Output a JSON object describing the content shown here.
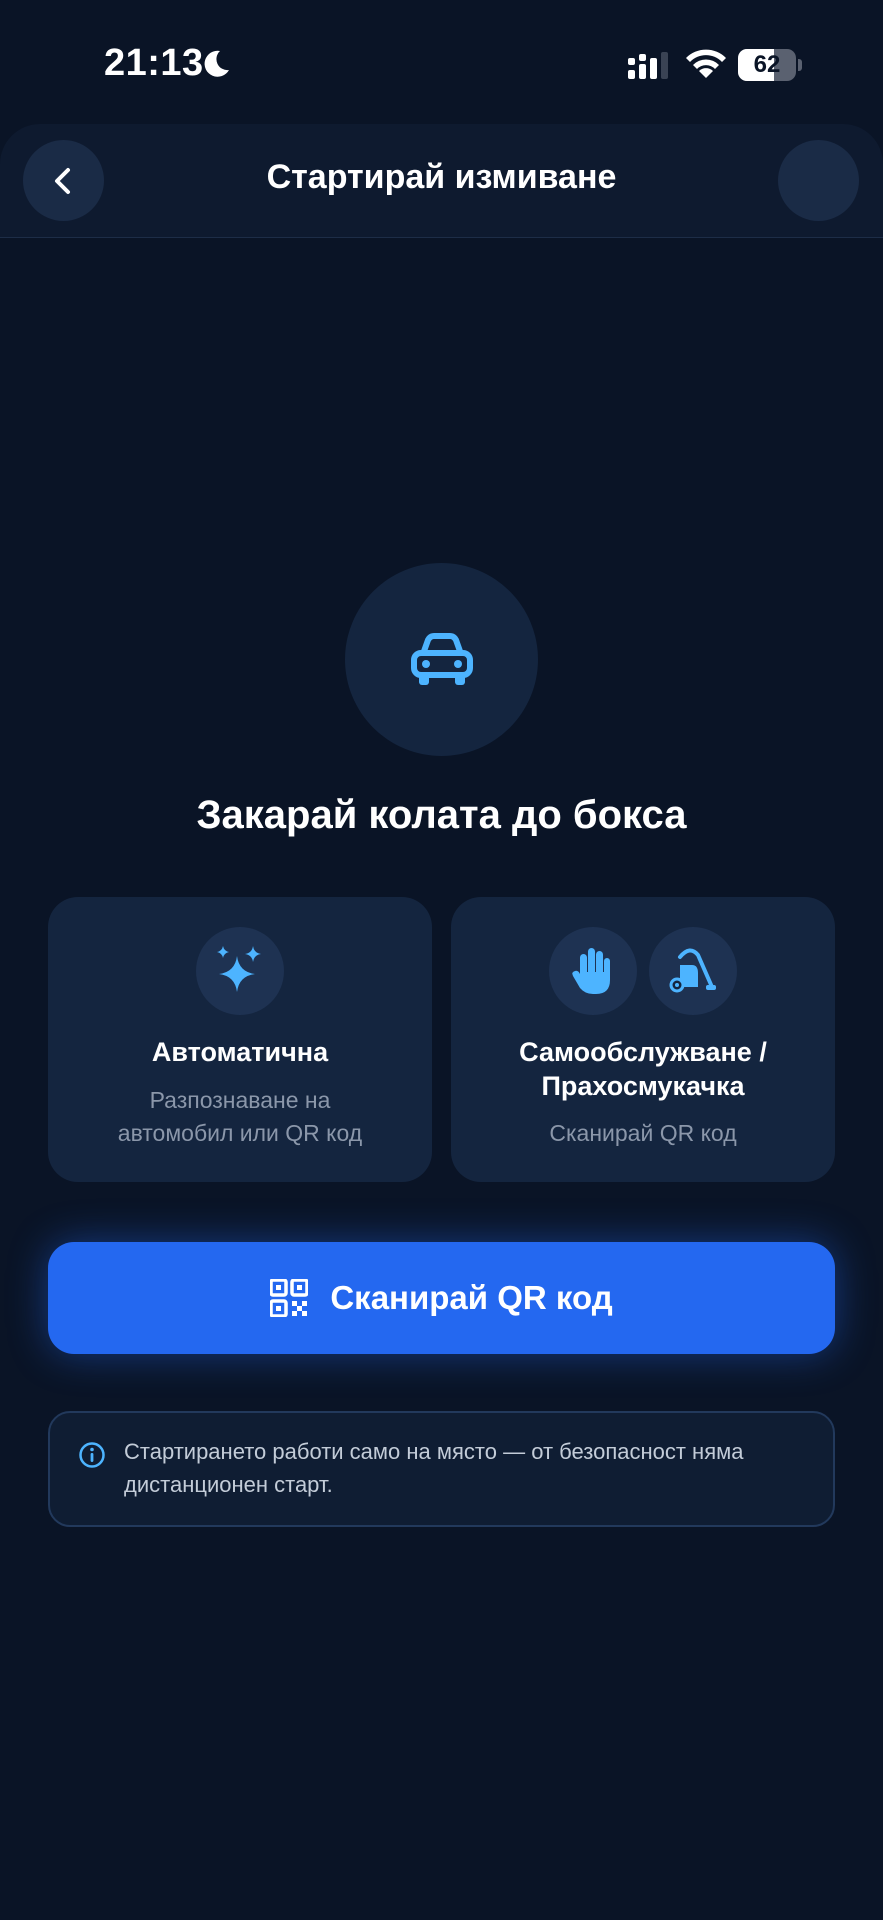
{
  "status_bar": {
    "time": "21:13",
    "battery_percent": 62,
    "battery_label": "62",
    "icons": [
      "moon-icon",
      "signal-icon",
      "wifi-icon",
      "battery-icon"
    ]
  },
  "header": {
    "title": "Стартирай измиване",
    "back_icon": "chevron-left-icon"
  },
  "hero": {
    "icon": "car-icon",
    "title": "Закарай колата до бокса"
  },
  "cards": {
    "automatic": {
      "icon": "sparkles-icon",
      "title": "Автоматична",
      "desc_line1": "Разпознаване на",
      "desc_line2": "автомобил или QR код"
    },
    "self_service": {
      "icons": [
        "hand-icon",
        "vacuum-icon"
      ],
      "title_line1": "Самообслужване /",
      "title_line2": "Прахосмукачка",
      "desc": "Сканирай QR код"
    }
  },
  "scan_button": {
    "icon": "qr-code-icon",
    "label": "Сканирай QR код"
  },
  "info": {
    "icon": "info-icon",
    "line1": "Стартирането работи само на място — от безопасност няма",
    "line2": "дистанционен старт."
  },
  "colors": {
    "background": "#0a1426",
    "card": "#14253f",
    "accent": "#2468f0",
    "icon_blue": "#4db4ff",
    "muted_text": "#8b97aa"
  }
}
